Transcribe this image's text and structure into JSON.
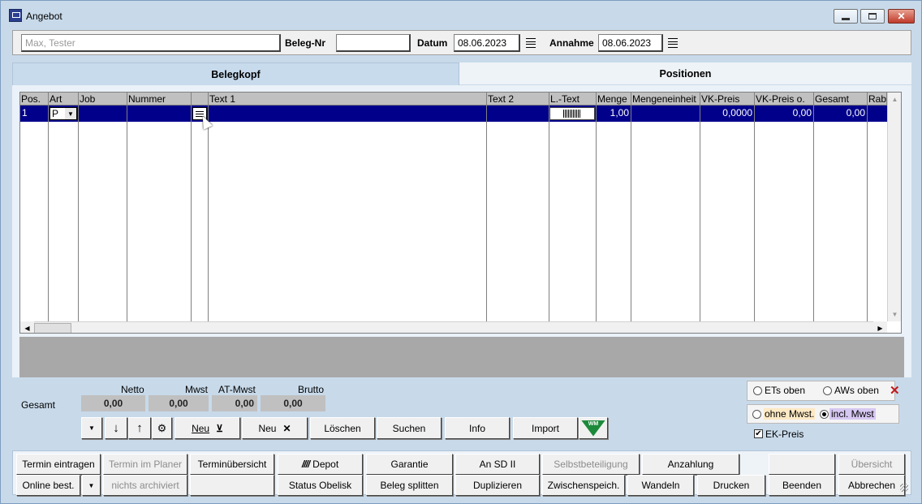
{
  "window": {
    "title": "Angebot"
  },
  "header": {
    "customer_placeholder": "Max, Tester",
    "beleg_nr_label": "Beleg-Nr",
    "beleg_nr_value": "",
    "datum_label": "Datum",
    "datum_value": "08.06.2023",
    "annahme_label": "Annahme",
    "annahme_value": "08.06.2023"
  },
  "tabs": {
    "belegkopf": "Belegkopf",
    "positionen": "Positionen"
  },
  "grid": {
    "columns": [
      "Pos.",
      "Art",
      "Job",
      "Nummer",
      "",
      "Text 1",
      "Text 2",
      "L.-Text",
      "Menge",
      "Mengeneinheit",
      "VK-Preis",
      "VK-Preis o.",
      "Gesamt",
      "Rab"
    ],
    "row": {
      "pos": "1",
      "art": "P",
      "job": "",
      "nummer": "",
      "text1": "",
      "text2": "",
      "menge": "1,00",
      "einheit": "",
      "vk_preis": "0,0000",
      "vk_preis_o": "0,00",
      "gesamt": "0,00",
      "rab": ""
    }
  },
  "totals": {
    "label": "Gesamt",
    "netto_label": "Netto",
    "netto": "0,00",
    "mwst_label": "Mwst",
    "mwst": "0,00",
    "atmwst_label": "AT-Mwst",
    "atmwst": "0,00",
    "brutto_label": "Brutto",
    "brutto": "0,00"
  },
  "actions": {
    "neu1": "Neu",
    "neu2": "Neu",
    "loeschen": "Löschen",
    "suchen": "Suchen",
    "info": "Info",
    "import": "Import",
    "wm_logo": "WM"
  },
  "options": {
    "ets_oben": "ETs oben",
    "aws_oben": "AWs oben",
    "ohne_mwst": "ohne Mwst.",
    "incl_mwst": "incl. Mwst",
    "ek_preis": "EK-Preis",
    "ek_checked": "✔"
  },
  "bottom": {
    "row1": [
      "Termin eintragen",
      "Termin im Planer",
      "Terminübersicht",
      "Depot",
      "Garantie",
      "An SD II",
      "Selbstbeteiligung",
      "Anzahlung",
      "",
      "Übersicht"
    ],
    "row2": [
      "Online best.",
      "nichts archiviert",
      "",
      "Status Obelisk",
      "Beleg splitten",
      "Duplizieren",
      "Zwischenspeich.",
      "Wandeln",
      "Drucken",
      "Beenden",
      "Abbrechen"
    ]
  },
  "colors": {
    "selection": "#00008b",
    "panel": "#c8daea",
    "danger": "#c0181a"
  }
}
